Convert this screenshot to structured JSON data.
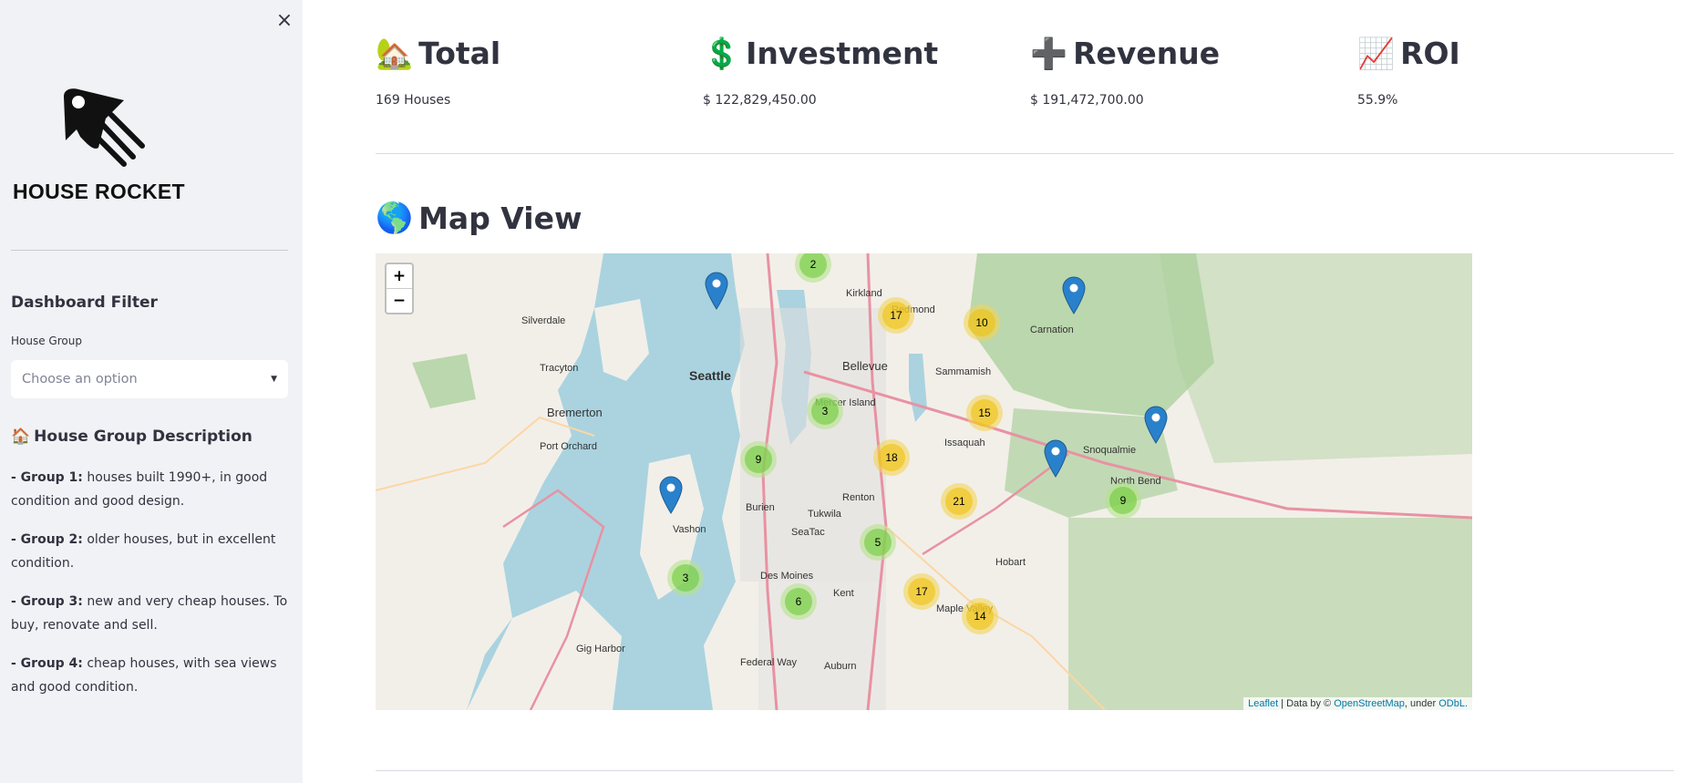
{
  "sidebar": {
    "close_icon": "×",
    "logo_text": "HOUSE ROCKET",
    "filter_title": "Dashboard Filter",
    "filter_label": "House Group",
    "select_placeholder": "Choose an option",
    "desc_icon": "🏠",
    "desc_title": "House Group Description",
    "groups": [
      {
        "label": "- Group 1:",
        "text": " houses built 1990+, in good condition and good design."
      },
      {
        "label": "- Group 2:",
        "text": " older houses, but in excellent condition."
      },
      {
        "label": "- Group 3:",
        "text": " new and very cheap houses. To buy, renovate and sell."
      },
      {
        "label": "- Group 4:",
        "text": " cheap houses, with sea views and good condition."
      }
    ]
  },
  "metrics": [
    {
      "icon": "🏡",
      "label": "Total",
      "value": "169 Houses"
    },
    {
      "icon": "💲",
      "label": "Investment",
      "value": "$ 122,829,450.00"
    },
    {
      "icon": "➕",
      "label": "Revenue",
      "value": "$ 191,472,700.00"
    },
    {
      "icon": "📈",
      "label": "ROI",
      "value": "55.9%"
    }
  ],
  "map_section": {
    "icon": "🌎",
    "title": "Map View"
  },
  "map": {
    "zoom_in": "+",
    "zoom_out": "−",
    "clusters": [
      "2",
      "17",
      "10",
      "3",
      "15",
      "9",
      "18",
      "21",
      "9",
      "5",
      "3",
      "6",
      "17",
      "14"
    ],
    "places": [
      "Seattle",
      "Bellevue",
      "Bremerton",
      "Kirkland",
      "Redmond",
      "Sammamish",
      "Issaquah",
      "Renton",
      "Burien",
      "Tukwila",
      "SeaTac",
      "Kent",
      "Des Moines",
      "Federal Way",
      "Auburn",
      "Vashon",
      "Gig Harbor",
      "Port Orchard",
      "Silverdale",
      "Snoqualmie",
      "North Bend",
      "Carnation",
      "Hobart",
      "Maple Valley",
      "Mercer Island",
      "Tracyton"
    ],
    "attribution": {
      "leaflet": "Leaflet",
      "sep1": " | Data by © ",
      "osm": "OpenStreetMap",
      "sep2": ", under ",
      "odbl": "ODbL."
    }
  },
  "colors": {
    "sidebar_bg": "#f0f2f6",
    "water": "#aad3df",
    "land": "#f2efe9",
    "forest": "#add19e",
    "marker": "#2a81cb"
  }
}
